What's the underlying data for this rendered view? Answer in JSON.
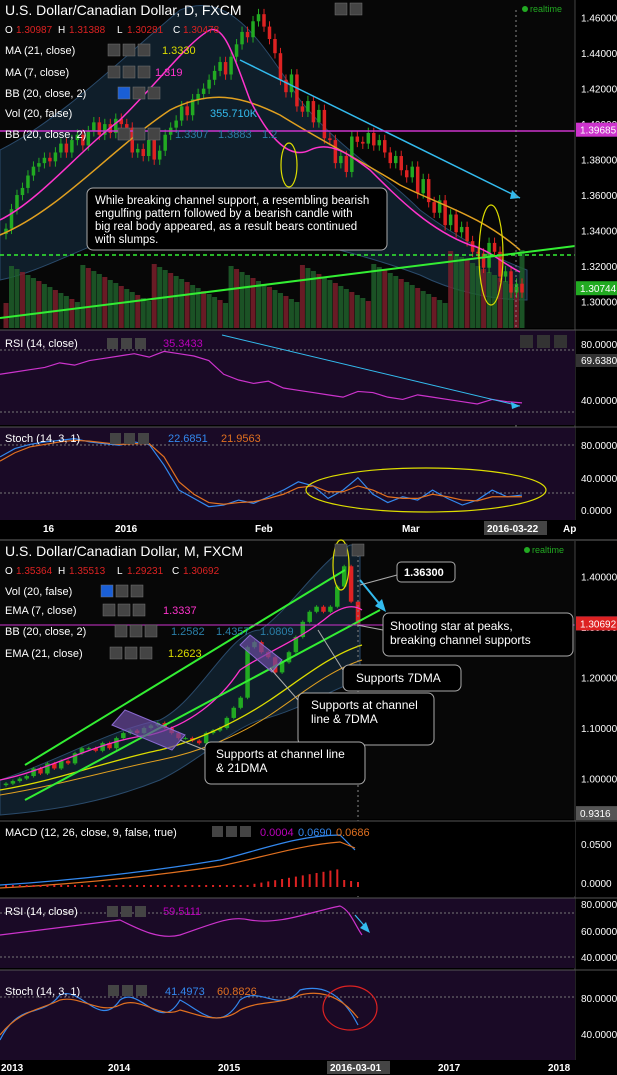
{
  "colors": {
    "bg": "#000000",
    "panel_sub": "#1a0a26",
    "bull": "#22aa22",
    "bear": "#dd2222",
    "pink": "#ff33cc",
    "orange": "#e0a020",
    "yellow": "#dddd00",
    "cyan": "#33bbee",
    "green": "#33ee33",
    "grid": "#2a2a2a",
    "axis_text": "#ffffff",
    "magenta_line": "#cc33cc"
  },
  "chart_data": [
    {
      "type": "candlestick",
      "title": "U.S. Dollar/Canadian Dollar, D, FXCM",
      "status": "realtime",
      "ohlc": {
        "o_label": "O",
        "o": "1.30987",
        "h_label": "H",
        "h": "1.31388",
        "l_label": "L",
        "l": "1.30281",
        "c_label": "C",
        "c": "1.30478"
      },
      "indicators": [
        {
          "name": "MA (21, close)",
          "value": "1.3330"
        },
        {
          "name": "MA (7, close)",
          "value": "1.319"
        },
        {
          "name": "BB (20, close, 2)",
          "value": ""
        },
        {
          "name": "Vol (20, false)",
          "values": [
            "",
            "355.710K"
          ]
        },
        {
          "name": "BB (20, close, 2)",
          "values": [
            "1.3307",
            "1.3883",
            "1.2"
          ]
        }
      ],
      "y_ticks": [
        "1.46000",
        "1.44000",
        "1.42000",
        "1.40000",
        "1.38000",
        "1.36000",
        "1.34000",
        "1.32000",
        "1.30000"
      ],
      "ylim": [
        1.285,
        1.47
      ],
      "price_tags": [
        {
          "value": "1.39685",
          "color": "#cc33cc"
        },
        {
          "value": "1.30744",
          "color": "#22aa22"
        }
      ],
      "closes": [
        1.341,
        1.352,
        1.36,
        1.364,
        1.371,
        1.376,
        1.378,
        1.381,
        1.379,
        1.384,
        1.389,
        1.384,
        1.391,
        1.394,
        1.388,
        1.396,
        1.401,
        1.394,
        1.4,
        1.395,
        1.403,
        1.4,
        1.398,
        1.384,
        1.386,
        1.382,
        1.391,
        1.38,
        1.385,
        1.394,
        1.398,
        1.402,
        1.41,
        1.405,
        1.414,
        1.417,
        1.42,
        1.425,
        1.43,
        1.435,
        1.428,
        1.438,
        1.445,
        1.452,
        1.449,
        1.458,
        1.462,
        1.455,
        1.448,
        1.44,
        1.425,
        1.418,
        1.428,
        1.41,
        1.407,
        1.413,
        1.401,
        1.408,
        1.392,
        1.391,
        1.378,
        1.382,
        1.373,
        1.393,
        1.39,
        1.389,
        1.395,
        1.388,
        1.391,
        1.384,
        1.378,
        1.382,
        1.374,
        1.37,
        1.376,
        1.361,
        1.369,
        1.356,
        1.35,
        1.357,
        1.343,
        1.349,
        1.339,
        1.342,
        1.334,
        1.328,
        1.327,
        1.319,
        1.333,
        1.328,
        1.314,
        1.317,
        1.305,
        1.31,
        1.305
      ],
      "annotation": "While breaking channel support, a resembling bearish engulfing pattern followed by a bearish candle with big real body appeared, as a result bears continued with slumps.",
      "subpanels": [
        {
          "name": "RSI (14, close)",
          "value": "35.3433",
          "y_ticks": [
            "80.0000",
            "40.0000"
          ],
          "tag": "69.6380",
          "values": [
            60,
            62,
            64,
            66,
            70,
            68,
            72,
            74,
            76,
            78,
            75,
            80,
            78,
            76,
            72,
            60,
            55,
            52,
            54,
            48,
            46,
            44,
            42,
            40,
            45,
            44,
            40,
            38,
            42,
            40,
            38,
            36,
            34,
            38,
            36,
            35
          ]
        },
        {
          "name": "Stoch (14, 3, 1)",
          "values": [
            "22.6851",
            "21.9563"
          ],
          "y_ticks": [
            "80.0000",
            "40.0000",
            "0.0000"
          ],
          "k": [
            70,
            80,
            85,
            88,
            90,
            92,
            88,
            86,
            84,
            88,
            85,
            60,
            30,
            20,
            10,
            12,
            18,
            14,
            22,
            30,
            40,
            35,
            20,
            30,
            45,
            25,
            15,
            22,
            18,
            30,
            20,
            12,
            18,
            30,
            22,
            24
          ],
          "d": [
            65,
            75,
            82,
            85,
            88,
            90,
            89,
            87,
            85,
            86,
            86,
            70,
            40,
            25,
            15,
            13,
            15,
            16,
            20,
            25,
            33,
            35,
            28,
            28,
            35,
            30,
            22,
            20,
            20,
            25,
            22,
            18,
            17,
            22,
            22,
            22
          ]
        }
      ],
      "x_ticks": [
        "16",
        "2016",
        "Feb",
        "Mar",
        "2016-03-22",
        "Ap"
      ]
    },
    {
      "type": "candlestick",
      "title": "U.S. Dollar/Canadian Dollar, M, FXCM",
      "status": "realtime",
      "ohlc": {
        "o_label": "O",
        "o": "1.35364",
        "h_label": "H",
        "h": "1.35513",
        "l_label": "L",
        "l": "1.29231",
        "c_label": "C",
        "c": "1.30692"
      },
      "indicators": [
        {
          "name": "Vol (20, false)",
          "value": ""
        },
        {
          "name": "EMA (7, close)",
          "value": "1.3337"
        },
        {
          "name": "BB (20, close, 2)",
          "values": [
            "1.2582",
            "1.4357",
            "1.0809"
          ]
        },
        {
          "name": "EMA (21, close)",
          "value": "1.2623"
        }
      ],
      "y_ticks": [
        "1.40000",
        "1.30000",
        "1.20000",
        "1.10000",
        "1.00000"
      ],
      "ylim": [
        0.92,
        1.47
      ],
      "price_tags": [
        {
          "value": "1.30700",
          "color": "#1a5fd6"
        },
        {
          "value": "1.30692",
          "color": "#dd2222"
        },
        {
          "value": "0.9316",
          "color": "#555555"
        }
      ],
      "closes": [
        0.99,
        0.995,
        1.0,
        1.005,
        1.02,
        1.01,
        1.03,
        1.02,
        1.035,
        1.03,
        1.05,
        1.06,
        1.06,
        1.055,
        1.07,
        1.06,
        1.08,
        1.09,
        1.095,
        1.09,
        1.1,
        1.105,
        1.11,
        1.1,
        1.09,
        1.08,
        1.08,
        1.075,
        1.07,
        1.09,
        1.095,
        1.1,
        1.12,
        1.14,
        1.16,
        1.26,
        1.27,
        1.25,
        1.24,
        1.21,
        1.23,
        1.25,
        1.28,
        1.31,
        1.33,
        1.34,
        1.33,
        1.34,
        1.38,
        1.42,
        1.35,
        1.307
      ],
      "annotations": [
        "Shooting star at peaks, breaking channel supports",
        "Supports 7DMA",
        "Supports at channel line & 7DMA",
        "Supports at channel line & 21DMA"
      ],
      "callout": "1.36300",
      "subpanels": [
        {
          "name": "MACD (12, 26, close, 9, false, true)",
          "values": [
            "0.0004",
            "0.0690",
            "0.0686"
          ],
          "y_ticks": [
            "0.0500",
            "0.0000"
          ]
        },
        {
          "name": "RSI (14, close)",
          "value": "59.5111",
          "y_ticks": [
            "80.0000",
            "60.0000",
            "40.0000"
          ]
        },
        {
          "name": "Stoch (14, 3, 1)",
          "values": [
            "41.4973",
            "60.8826"
          ],
          "y_ticks": [
            "80.0000",
            "40.0000"
          ]
        }
      ],
      "x_ticks": [
        "2013",
        "2014",
        "2015",
        "2016",
        "2016-03-01",
        "2017",
        "2018"
      ]
    }
  ]
}
